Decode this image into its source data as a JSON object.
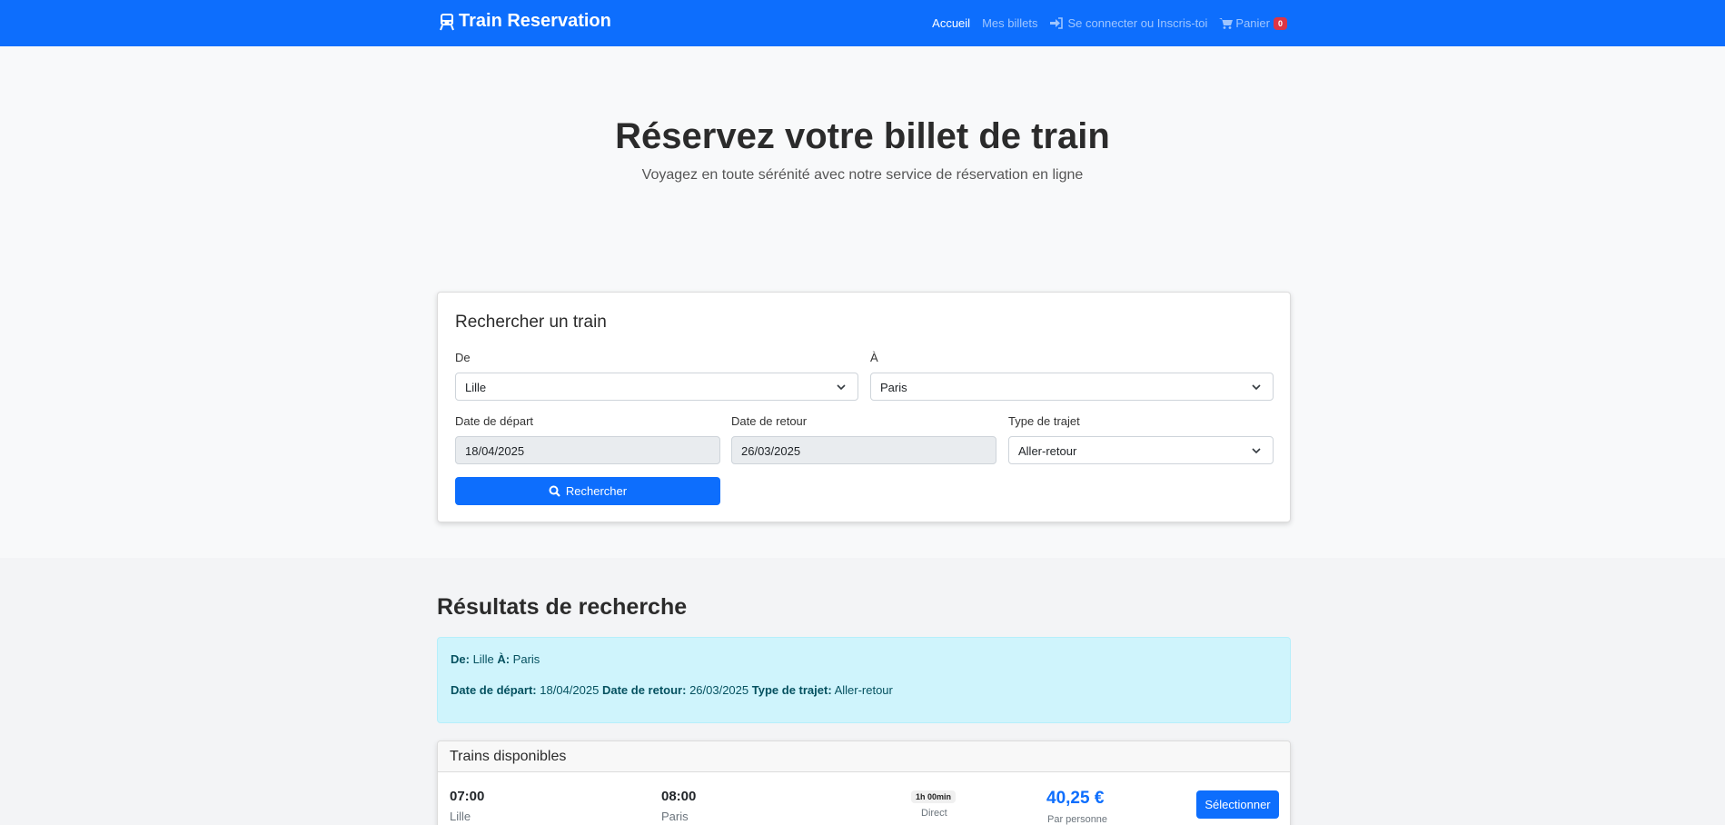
{
  "navbar": {
    "brand": "Train Reservation",
    "brand_icon": "train-icon",
    "links": {
      "home": "Accueil",
      "tickets": "Mes billets",
      "login": "Se connecter ou Inscris-toi",
      "cart": "Panier"
    },
    "cart_count": "0"
  },
  "hero": {
    "title": "Réservez votre billet de train",
    "subtitle": "Voyagez en toute sérénité avec notre service de réservation en ligne"
  },
  "search": {
    "title": "Rechercher un train",
    "from_label": "De",
    "from_value": "Lille",
    "to_label": "À",
    "to_value": "Paris",
    "depart_label": "Date de départ",
    "depart_value": "18/04/2025",
    "return_label": "Date de retour",
    "return_value": "26/03/2025",
    "trip_type_label": "Type de trajet",
    "trip_type_value": "Aller-retour",
    "button": "Rechercher"
  },
  "results": {
    "title": "Résultats de recherche",
    "summary": {
      "from_key": "De:",
      "from_value": "Lille",
      "to_key": "À:",
      "to_value": "Paris",
      "depart_key": "Date de départ:",
      "depart_value": "18/04/2025",
      "return_key": "Date de retour:",
      "return_value": "26/03/2025",
      "type_key": "Type de trajet:",
      "type_value": "Aller-retour"
    },
    "trains_header": "Trains disponibles",
    "trains": [
      {
        "depart_time": "07:00",
        "depart_city": "Lille",
        "arrive_time": "08:00",
        "arrive_city": "Paris",
        "duration": "1h 00min",
        "type": "Direct",
        "price": "40,25 €",
        "price_note": "Par personne",
        "button": "Sélectionner"
      }
    ]
  },
  "colors": {
    "primary": "#0d6efd",
    "badge": "#dc3545",
    "info_bg": "#cff4fc"
  }
}
